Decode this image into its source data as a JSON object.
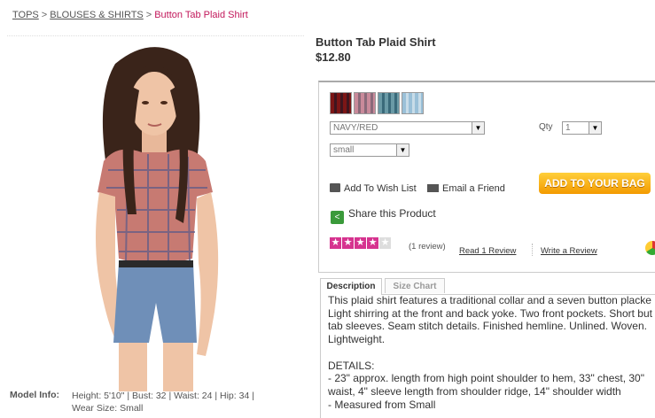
{
  "breadcrumb": {
    "item1": "TOPS",
    "item2": "BLOUSES & SHIRTS",
    "current": "Button Tab Plaid Shirt",
    "sep": ">"
  },
  "product": {
    "title": "Button Tab Plaid Shirt",
    "price": "$12.80"
  },
  "model_info": {
    "label": "Model Info:",
    "line1": "Height: 5'10\" | Bust: 32 | Waist: 24 | Hip: 34 |",
    "line2": "Wear Size: Small"
  },
  "swatches": [
    {
      "name": "navy-red",
      "colors": [
        "#b24a4a",
        "#5a4a6a"
      ]
    },
    {
      "name": "pink",
      "colors": [
        "#c98a9a",
        "#8a6a7a"
      ]
    },
    {
      "name": "teal",
      "colors": [
        "#6a9aa6",
        "#3a6a7a"
      ]
    },
    {
      "name": "blue",
      "colors": [
        "#9ac0d8",
        "#c8dce8"
      ]
    }
  ],
  "color_select": {
    "value": "NAVY/RED"
  },
  "size_select": {
    "value": "small"
  },
  "qty": {
    "label": "Qty",
    "value": "1"
  },
  "actions": {
    "wishlist": "Add To Wish List",
    "email": "Email a Friend",
    "share": "Share this Product",
    "add_to_bag": "ADD TO YOUR BAG"
  },
  "rating": {
    "stars_filled": 4,
    "stars_total": 5,
    "count_text": "(1 review)",
    "read": "Read 1 Review",
    "write": "Write a Review"
  },
  "tabs": {
    "description": "Description",
    "size_chart": "Size Chart"
  },
  "description": {
    "lines": [
      "This plaid shirt features a traditional collar and a seven button placke",
      "Light shirring at the front and back yoke. Two front pockets. Short but",
      "tab sleeves. Seam stitch details. Finished hemline. Unlined. Woven.",
      "Lightweight.",
      "",
      "DETAILS:",
      "- 23\" approx. length from high point shoulder to hem, 33\" chest, 30\"",
      "waist, 4\" sleeve length from shoulder ridge, 14\" shoulder width",
      "- Measured from Small"
    ]
  },
  "colors": {
    "accent_pink": "#c2185b",
    "star_pink": "#d6338f",
    "bag_orange": "#f39a00",
    "share_green": "#3a9a3a"
  }
}
